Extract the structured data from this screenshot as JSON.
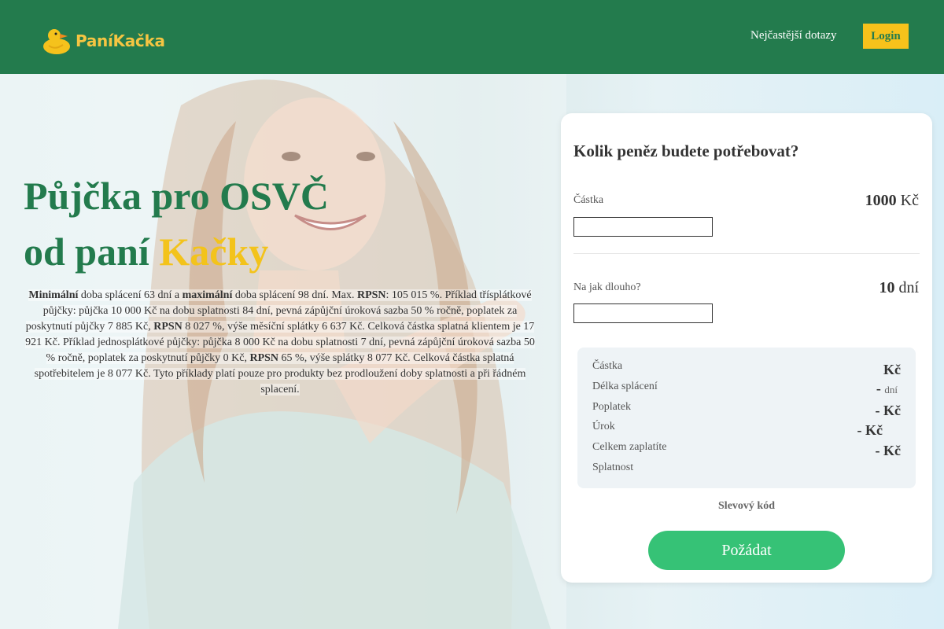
{
  "header": {
    "logo_text_1": "Paní",
    "logo_text_2": "Kačka",
    "faq_link": "Nejčastější dotazy",
    "login_button": "Login"
  },
  "hero": {
    "headline_line1": "Půjčka pro OSVČ",
    "headline_prefix": "od paní ",
    "headline_accent": "Kačky",
    "disclaimer": {
      "b1": "Minimální",
      "t1": " doba splácení 63 dní a ",
      "b2": "maximální",
      "t2": " doba splácení 98 dní. Max. ",
      "b3": "RPSN",
      "t3": ": 105 015 %. Příklad třísplátkové půjčky: půjčka 10 000 Kč na dobu splatnosti 84 dní, pevná zápůjční úroková sazba 50 % ročně, poplatek za poskytnutí půjčky 7 885 Kč, ",
      "b4": "RPSN",
      "t4": " 8 027 %, výše měsíční splátky 6 637 Kč. Celková částka splatná klientem je 17 921 Kč. Příklad jednosplátkové půjčky: půjčka 8 000 Kč na dobu splatnosti 7 dní, pevná zápůjční úroková sazba 50 % ročně, poplatek za poskytnutí půjčky 0 Kč, ",
      "b5": "RPSN",
      "t5": " 65 %, výše splátky 8 077 Kč. Celková částka splatná spotřebitelem je 8 077 Kč. Tyto příklady platí pouze pro produkty bez prodloužení doby splatnosti a při řádném splacení."
    }
  },
  "calculator": {
    "title": "Kolik peněz budete potřebovat?",
    "amount": {
      "label": "Částka",
      "value": "1000",
      "unit": "Kč",
      "input_value": ""
    },
    "duration": {
      "label": "Na jak dlouho?",
      "value": "10",
      "unit": "dní",
      "input_value": ""
    },
    "summary": [
      {
        "label": "Částka",
        "value": "",
        "unit": "Kč"
      },
      {
        "label": "Délka splácení",
        "value": "-",
        "unit": "dní"
      },
      {
        "label": "Poplatek",
        "value": "-",
        "unit": "Kč"
      },
      {
        "label": "Úrok",
        "value": "-",
        "unit": "Kč"
      },
      {
        "label": "Celkem zaplatíte",
        "value": "-",
        "unit": "Kč"
      },
      {
        "label": "Splatnost",
        "value": "",
        "unit": ""
      }
    ],
    "promo_code": "Slevový kód",
    "submit_button": "Požádat"
  },
  "colors": {
    "header_green": "#237b4d",
    "accent_yellow": "#f3c31b",
    "button_green": "#36c276"
  }
}
